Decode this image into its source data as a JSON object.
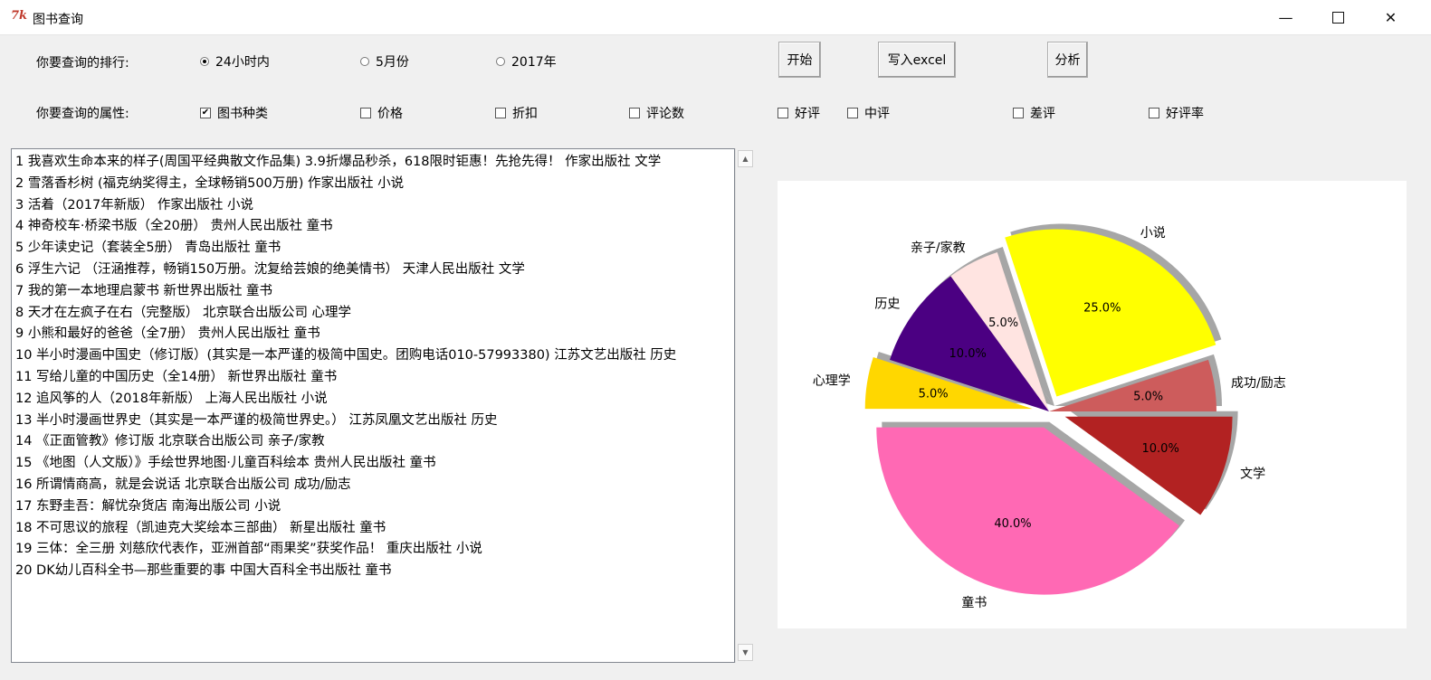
{
  "window": {
    "title": "图书查询",
    "icon": "tk-icon"
  },
  "controls": {
    "rank_label": "你要查询的排行:",
    "rank_options": [
      {
        "label": "24小时内",
        "selected": true
      },
      {
        "label": "5月份",
        "selected": false
      },
      {
        "label": "2017年",
        "selected": false
      }
    ],
    "attr_label": "你要查询的属性:",
    "attr_options": [
      {
        "label": "图书种类",
        "checked": true
      },
      {
        "label": "价格",
        "checked": false
      },
      {
        "label": "折扣",
        "checked": false
      },
      {
        "label": "评论数",
        "checked": false
      },
      {
        "label": "好评",
        "checked": false
      },
      {
        "label": "中评",
        "checked": false
      },
      {
        "label": "差评",
        "checked": false
      },
      {
        "label": "好评率",
        "checked": false
      }
    ],
    "buttons": {
      "start": "开始",
      "excel": "写入excel",
      "analyze": "分析"
    }
  },
  "results": [
    "1 我喜欢生命本来的样子(周国平经典散文作品集) 3.9折爆品秒杀，618限时钜惠！先抢先得！ 作家出版社 文学",
    "2 雪落香杉树 (福克纳奖得主，全球畅销500万册) 作家出版社 小说",
    "3 活着（2017年新版） 作家出版社 小说",
    "4 神奇校车·桥梁书版（全20册） 贵州人民出版社 童书",
    "5 少年读史记（套装全5册） 青岛出版社 童书",
    "6 浮生六记 （汪涵推荐，畅销150万册。沈复给芸娘的绝美情书） 天津人民出版社 文学",
    "7 我的第一本地理启蒙书 新世界出版社 童书",
    "8 天才在左疯子在右（完整版） 北京联合出版公司 心理学",
    "9 小熊和最好的爸爸（全7册） 贵州人民出版社 童书",
    "10 半小时漫画中国史（修订版）(其实是一本严谨的极简中国史。团购电话010-57993380) 江苏文艺出版社 历史",
    "11 写给儿童的中国历史（全14册） 新世界出版社 童书",
    "12 追风筝的人（2018年新版） 上海人民出版社 小说",
    "13 半小时漫画世界史（其实是一本严谨的极简世界史。） 江苏凤凰文艺出版社 历史",
    "14 《正面管教》修订版 北京联合出版公司 亲子/家教",
    "15 《地图（人文版）》手绘世界地图·儿童百科绘本 贵州人民出版社 童书",
    "16 所谓情商高，就是会说话 北京联合出版公司 成功/励志",
    "17 东野圭吾：解忧杂货店 南海出版公司 小说",
    "18 不可思议的旅程（凯迪克大奖绘本三部曲） 新星出版社 童书",
    "19 三体：全三册 刘慈欣代表作，亚洲首部“雨果奖”获奖作品！ 重庆出版社 小说",
    "20 DK幼儿百科全书—那些重要的事 中国大百科全书出版社 童书"
  ],
  "chart_data": {
    "type": "pie",
    "title": "",
    "startangle_deg": 180,
    "shadow": true,
    "slices": [
      {
        "label": "童书",
        "value": 40.0,
        "pct": "40.0%",
        "color": "#ff69b4",
        "explode": true
      },
      {
        "label": "文学",
        "value": 10.0,
        "pct": "10.0%",
        "color": "#b22222",
        "explode": true
      },
      {
        "label": "成功/励志",
        "value": 5.0,
        "pct": "5.0%",
        "color": "#cd5c5c",
        "explode": false
      },
      {
        "label": "小说",
        "value": 25.0,
        "pct": "25.0%",
        "color": "#ffff00",
        "explode": true
      },
      {
        "label": "亲子/家教",
        "value": 5.0,
        "pct": "5.0%",
        "color": "#ffe4e1",
        "explode": false
      },
      {
        "label": "历史",
        "value": 10.0,
        "pct": "10.0%",
        "color": "#4b0082",
        "explode": false
      },
      {
        "label": "心理学",
        "value": 5.0,
        "pct": "5.0%",
        "color": "#ffd700",
        "explode": true
      }
    ]
  }
}
